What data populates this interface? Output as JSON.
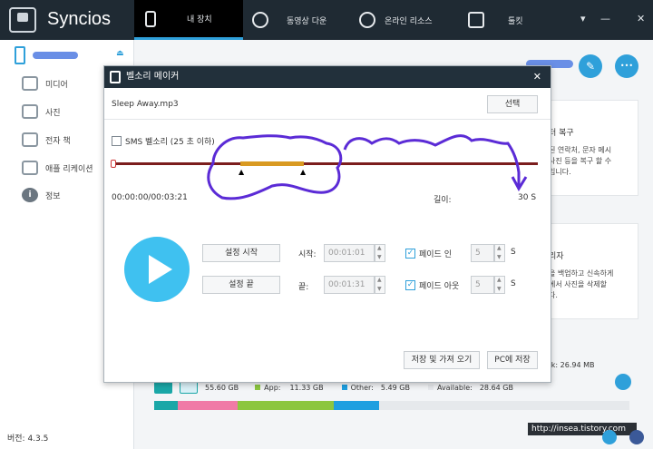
{
  "app": {
    "brand": "Syncios",
    "version": "버전: 4.3.5",
    "watermark": "http://insea.tistory.com"
  },
  "nav": {
    "tabs": [
      {
        "label": "내 장치",
        "active": true
      },
      {
        "label": "동영상 다운"
      },
      {
        "label": "온라인 리소스"
      },
      {
        "label": "툴킷"
      }
    ],
    "controls": {
      "menu": "▾",
      "min": "—",
      "close": "✕"
    }
  },
  "sidebar": {
    "items": [
      {
        "label": "미디어",
        "icon": "tv-icon"
      },
      {
        "label": "사진",
        "icon": "photo-icon"
      },
      {
        "label": "전자 책",
        "icon": "book-icon"
      },
      {
        "label": "애플 리케이션",
        "icon": "apps-icon"
      },
      {
        "label": "정보",
        "icon": "info-icon",
        "glyph": "i"
      }
    ]
  },
  "cards": {
    "card1": {
      "title": "터 복구",
      "body": "된 연락처, 문자 메시\n사진 등을 복구 할 수\n입니다."
    },
    "card2": {
      "title": "리자",
      "body": "을 백업하고 신속하게\n에서 사진을 삭제할\n다."
    }
  },
  "storage": {
    "used": "55.60 GB",
    "app": "App:",
    "app_val": "11.33 GB",
    "other": "Other:",
    "other_val": "5.49 GB",
    "available": "Available:",
    "available_val": "28.64 GB",
    "book": "ook: 26.94 MB",
    "colors": {
      "teal": "#1aa7a7",
      "pink": "#f07aa6",
      "green": "#8cc63f",
      "blue": "#1e9fe0",
      "gray": "#e6e9ec"
    }
  },
  "dialog": {
    "title": "벨소리 메이커",
    "filename": "Sleep Away.mp3",
    "select_btn": "선택",
    "sms_label": "SMS 벨소리 (25 초 이하)",
    "time": "00:00:00/00:03:21",
    "length_label": "길이:",
    "length_value": "30 S",
    "set_start": "설정 시작",
    "set_end": "설정 끝",
    "start_label": "시작:",
    "start_value": "00:01:01",
    "end_label": "끝:",
    "end_value": "00:01:31",
    "fade_in": "페이드 인",
    "fade_in_val": "5",
    "fade_out": "페이드 아웃",
    "fade_out_val": "5",
    "unit_s": "S",
    "save_import": "저장 및 가져 오기",
    "save_pc": "PC에 저장",
    "check": "✓",
    "close": "✕"
  },
  "misc": {
    "edit": "✎",
    "more": "•••",
    "eject": "⏏"
  }
}
